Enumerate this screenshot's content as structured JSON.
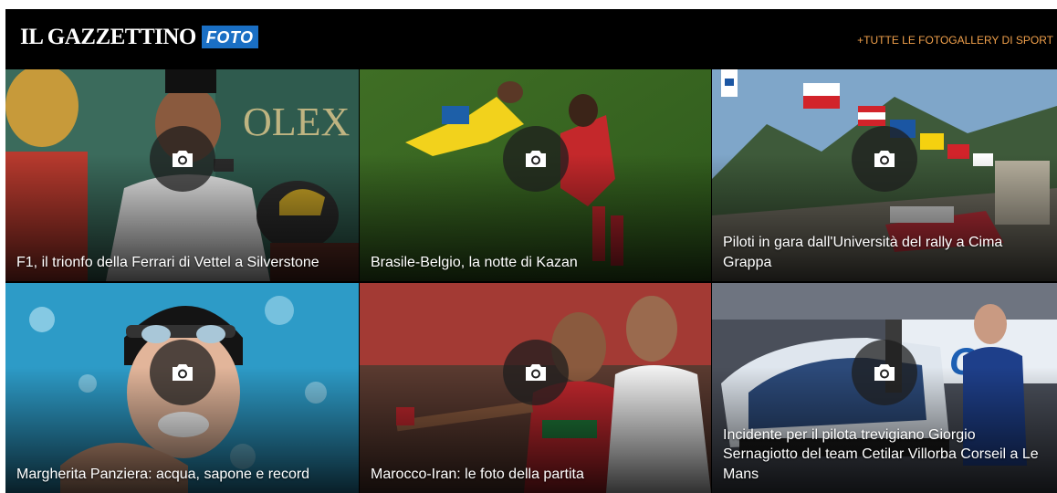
{
  "brand": {
    "name": "IL GAZZETTINO",
    "badge": "FOTO",
    "badge_color": "#1a6fc4"
  },
  "header": {
    "all_galleries_link": "+TUTTE LE FOTOGALLERY DI SPORT",
    "link_color": "#f0a04b"
  },
  "gallery_icon": "camera-icon",
  "galleries": [
    {
      "caption": "F1, il trionfo della Ferrari di Vettel a Silverstone",
      "icon": "camera-icon"
    },
    {
      "caption": "Brasile-Belgio, la notte di Kazan",
      "icon": "camera-icon"
    },
    {
      "caption": "Piloti in gara dall'Università del rally a Cima Grappa",
      "icon": "camera-icon"
    },
    {
      "caption": "Margherita Panziera: acqua, sapone e record",
      "icon": "camera-icon"
    },
    {
      "caption": "Marocco-Iran: le foto della partita",
      "icon": "camera-icon"
    },
    {
      "caption": "Incidente per il pilota trevigiano Giorgio Sernagiotto del team Cetilar Villorba Corseil a Le Mans",
      "icon": "camera-icon"
    }
  ]
}
